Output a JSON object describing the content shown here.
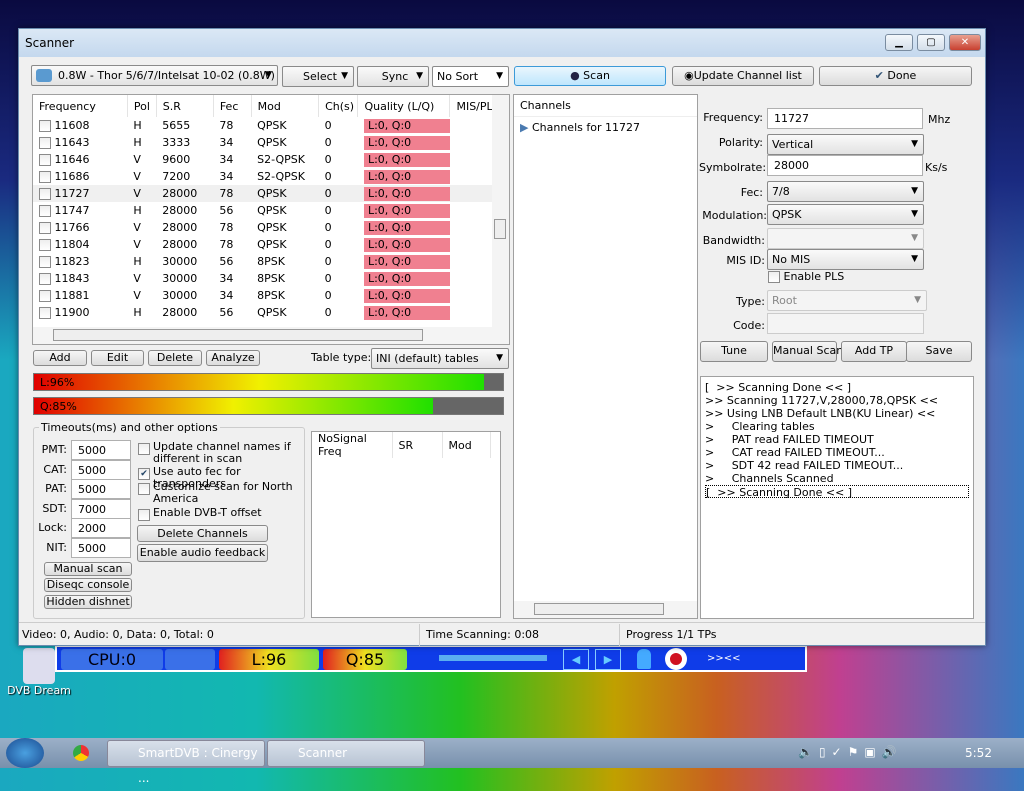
{
  "window": {
    "title": "Scanner",
    "min": "▁",
    "max": "▢",
    "close": "✕"
  },
  "toolbar": {
    "satellite": "0.8W - Thor 5/6/7/Intelsat 10-02 (0.8W)",
    "select": "Select",
    "sync": "Sync",
    "sort": "No Sort",
    "scan": "Scan",
    "update": "Update Channel list",
    "done": "Done"
  },
  "tp_table": {
    "headers": [
      "Frequency",
      "Pol",
      "S.R",
      "Fec",
      "Mod",
      "Ch(s)",
      "Quality (L/Q)",
      "MIS/PLS"
    ],
    "rows": [
      [
        "11608",
        "H",
        "5655",
        "78",
        "QPSK",
        "0",
        "L:0, Q:0"
      ],
      [
        "11643",
        "H",
        "3333",
        "34",
        "QPSK",
        "0",
        "L:0, Q:0"
      ],
      [
        "11646",
        "V",
        "9600",
        "34",
        "S2-QPSK",
        "0",
        "L:0, Q:0"
      ],
      [
        "11686",
        "V",
        "7200",
        "34",
        "S2-QPSK",
        "0",
        "L:0, Q:0"
      ],
      [
        "11727",
        "V",
        "28000",
        "78",
        "QPSK",
        "0",
        "L:0, Q:0"
      ],
      [
        "11747",
        "H",
        "28000",
        "56",
        "QPSK",
        "0",
        "L:0, Q:0"
      ],
      [
        "11766",
        "V",
        "28000",
        "78",
        "QPSK",
        "0",
        "L:0, Q:0"
      ],
      [
        "11804",
        "V",
        "28000",
        "78",
        "QPSK",
        "0",
        "L:0, Q:0"
      ],
      [
        "11823",
        "H",
        "30000",
        "56",
        "8PSK",
        "0",
        "L:0, Q:0"
      ],
      [
        "11843",
        "V",
        "30000",
        "34",
        "8PSK",
        "0",
        "L:0, Q:0"
      ],
      [
        "11881",
        "V",
        "30000",
        "34",
        "8PSK",
        "0",
        "L:0, Q:0"
      ],
      [
        "11900",
        "H",
        "28000",
        "56",
        "QPSK",
        "0",
        "L:0, Q:0"
      ]
    ],
    "selected_index": 4
  },
  "tp_buttons": {
    "add": "Add",
    "edit": "Edit",
    "delete": "Delete",
    "analyze": "Analyze",
    "table_type_label": "Table type:",
    "table_type": "INI (default) tables"
  },
  "levels": {
    "signal_label": "L:96%",
    "signal": 96,
    "quality_label": "Q:85%",
    "quality": 85
  },
  "options": {
    "legend": "Timeouts(ms) and other options",
    "timeouts": [
      {
        "label": "PMT:",
        "value": "5000"
      },
      {
        "label": "CAT:",
        "value": "5000"
      },
      {
        "label": "PAT:",
        "value": "5000"
      },
      {
        "label": "SDT:",
        "value": "7000"
      },
      {
        "label": "Lock:",
        "value": "2000"
      },
      {
        "label": "NIT:",
        "value": "5000"
      }
    ],
    "checks": [
      {
        "label": "Update channel names if different in scan",
        "checked": false
      },
      {
        "label": "Use auto fec for transponders",
        "checked": true
      },
      {
        "label": "Customize scan for North America",
        "checked": false
      },
      {
        "label": "Enable DVB-T offset",
        "checked": false
      }
    ],
    "delete_channels": "Delete Channels",
    "audio_feedback": "Enable audio feedback",
    "manual_scan": "Manual scan",
    "diseqc": "Diseqc console",
    "hidden_dishnet": "Hidden dishnet"
  },
  "nosignal": {
    "headers": [
      "NoSignal Freq",
      "SR",
      "Mod"
    ]
  },
  "channels": {
    "header": "Channels",
    "node": "Channels for 11727"
  },
  "form": {
    "frequency_label": "Frequency:",
    "frequency": "11727",
    "frequency_unit": "Mhz",
    "polarity_label": "Polarity:",
    "polarity": "Vertical",
    "symbolrate_label": "Symbolrate:",
    "symbolrate": "28000",
    "symbolrate_unit": "Ks/s",
    "fec_label": "Fec:",
    "fec": "7/8",
    "modulation_label": "Modulation:",
    "modulation": "QPSK",
    "bandwidth_label": "Bandwidth:",
    "mis_label": "MIS ID:",
    "mis": "No MIS",
    "pls_label": "Enable PLS",
    "type_label": "Type:",
    "type": "Root",
    "code_label": "Code:"
  },
  "form_buttons": {
    "tune": "Tune",
    "manual_scan": "Manual Scan",
    "add_tp": "Add TP",
    "save": "Save"
  },
  "log": [
    "[  >> Scanning Done << ]",
    ">> Scanning 11727,V,28000,78,QPSK <<",
    ">> Using LNB Default LNB(KU Linear) <<",
    ">     Clearing tables",
    ">     PAT read FAILED TIMEOUT",
    ">     CAT read FAILED TIMEOUT...",
    ">     SDT 42 read FAILED TIMEOUT...",
    ">     Channels Scanned",
    "[  >> Scanning Done << ]"
  ],
  "status": {
    "counts": "Video: 0, Audio: 0, Data: 0, Total: 0",
    "time": "Time Scanning: 0:08",
    "progress": "Progress 1/1 TPs"
  },
  "smartdvb": {
    "cpu": "CPU:0",
    "level": "L:96",
    "quality": "Q:85",
    "ticker": ">><<"
  },
  "desktop": {
    "icon": "DVB Dream"
  },
  "taskbar": {
    "items": [
      "SmartDVB : Cinergy ...",
      "Scanner"
    ],
    "clock": "5:52"
  }
}
